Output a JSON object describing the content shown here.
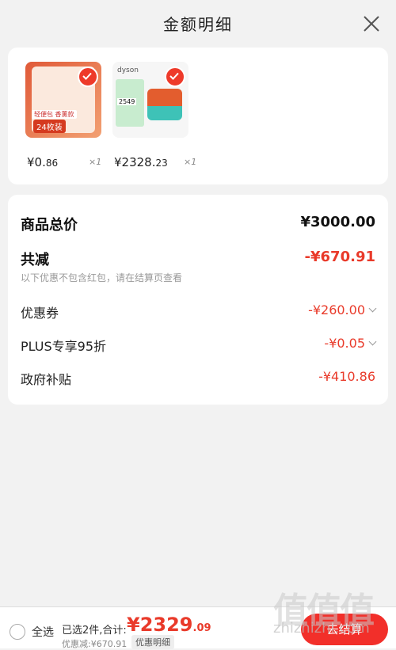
{
  "header": {
    "title": "金额明细"
  },
  "products": [
    {
      "price_int": "¥0.",
      "price_dec": "86",
      "qty": "×1",
      "tag": "24枚装",
      "tag_small": "轻便包 香薰款"
    },
    {
      "price_int": "¥2328.",
      "price_dec": "23",
      "qty": "×1",
      "brand": "dyson",
      "inner_price": "2549"
    }
  ],
  "breakdown": {
    "subtotal_label": "商品总价",
    "subtotal_value": "¥3000.00",
    "reduce_label": "共减",
    "reduce_value": "-¥670.91",
    "note": "以下优惠不包含红包，请在结算页查看",
    "coupon_label": "优惠券",
    "coupon_value": "-¥260.00",
    "plus_label": "PLUS专享95折",
    "plus_value": "-¥0.05",
    "gov_label": "政府补贴",
    "gov_value": "-¥410.86"
  },
  "bottom": {
    "select_all": "全选",
    "selected_text": "已选2件,合计:",
    "total_int": "¥2329",
    "total_dec": ".09",
    "discount_text": "优惠减:¥670.91",
    "detail_button": "优惠明细",
    "settle_button": "去结算"
  },
  "watermark": {
    "text": "值值值",
    "site": "zhizhizhi.com"
  },
  "colors": {
    "accent": "#e93a2a",
    "settle": "#f22f2a"
  }
}
